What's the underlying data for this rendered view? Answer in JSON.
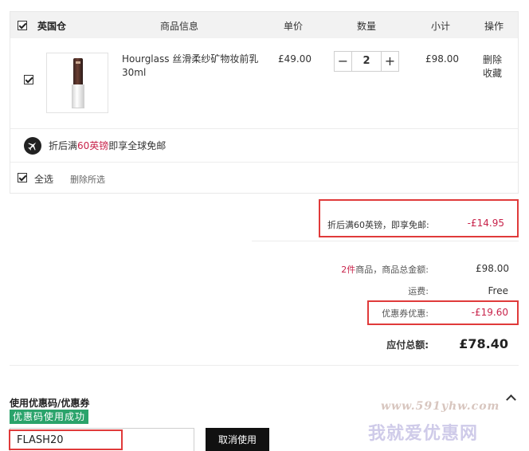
{
  "cart": {
    "header": {
      "warehouse": "英国仓",
      "col_info": "商品信息",
      "col_price": "单价",
      "col_qty": "数量",
      "col_subtotal": "小计",
      "col_action": "操作"
    },
    "item": {
      "name": "Hourglass 丝滑柔纱矿物妆前乳30ml",
      "price": "£49.00",
      "quantity": "2",
      "minus": "−",
      "plus": "+",
      "subtotal": "£98.00",
      "action_delete": "删除",
      "action_favorite": "收藏"
    },
    "shipping": {
      "prefix": "折后满",
      "highlight": "60英镑",
      "suffix": "即享全球免邮"
    },
    "select_all": "全选",
    "delete_selected": "删除所选"
  },
  "promo": {
    "label": "折后满60英镑，即享免邮:",
    "value": "-£14.95"
  },
  "summary": {
    "count": "2件",
    "count_label": "商品，商品总金额:",
    "goods_total": "£98.00",
    "shipping_label": "运费:",
    "shipping_value": "Free",
    "coupon_label": "优惠券优惠:",
    "coupon_value": "-£19.60",
    "total_label": "应付总额:",
    "total_value": "£78.40"
  },
  "coupon": {
    "title": "使用优惠码/优惠券",
    "success": "优惠码使用成功",
    "code": "FLASH20",
    "cancel_label": "取消使用"
  },
  "watermark": {
    "url": "www.591yhw.com",
    "text": "我就爱优惠网"
  },
  "colors": {
    "highlight_red": "#c8234a",
    "annotation_red": "#e03a3a",
    "success_green": "#2aa36b",
    "button_black": "#111111"
  }
}
